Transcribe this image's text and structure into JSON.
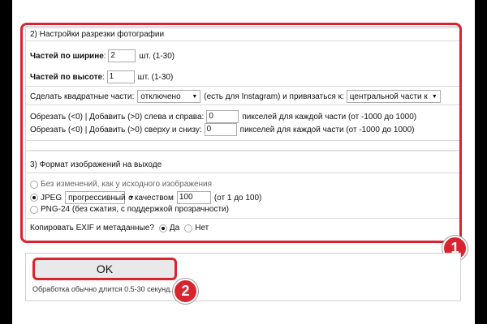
{
  "section2": {
    "title": "2) Настройки разрезки фотографии",
    "width_label": "Частей по ширине",
    "width_value": "2",
    "width_hint": "шт. (1-30)",
    "height_label": "Частей по высоте",
    "height_value": "1",
    "height_hint": "шт. (1-30)",
    "square_label": "Сделать квадратные части:",
    "square_select": "отключено",
    "square_mid": "(есть для Instagram) и привязаться к:",
    "anchor_select": "центральной части к",
    "crop_lr_label": "Обрезать (<0) | Добавить (>0) слева и справа:",
    "crop_lr_value": "0",
    "crop_lr_hint": "пикселей для каждой части (от -1000 до 1000)",
    "crop_tb_label": "Обрезать (<0) | Добавить (>0) сверху и снизу:",
    "crop_tb_value": "0",
    "crop_tb_hint": "пикселей для каждой части (от -1000 до 1000)"
  },
  "section3": {
    "title": "3) Формат изображений на выходе",
    "opt_nochange": "Без изменений, как у исходного изображения",
    "opt_jpeg": "JPEG",
    "jpeg_mode": "прогрессивный",
    "quality_label": "с качеством",
    "quality_value": "100",
    "quality_hint": "(от 1 до 100)",
    "opt_png": "PNG-24 (без сжатия, с поддержкой прозрачности)",
    "exif_label": "Копировать EXIF и метаданные?",
    "exif_yes": "Да",
    "exif_no": "Нет"
  },
  "ok_label": "OK",
  "note": "Обработка обычно длится 0.5-30 секунд.",
  "badges": {
    "one": "1",
    "two": "2"
  },
  "colors": {
    "accent": "#d9242f"
  }
}
